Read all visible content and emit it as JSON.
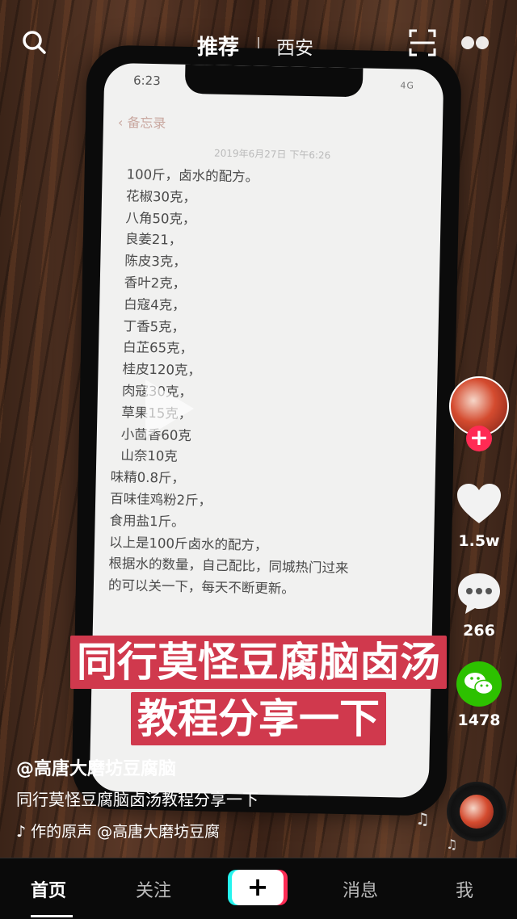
{
  "topbar": {
    "tab_recommend": "推荐",
    "tab_city": "西安"
  },
  "phone_screen": {
    "time": "6:23",
    "status": "4G",
    "back_label": "备忘录",
    "date": "2019年6月27日 下午6:26",
    "note_lines": [
      "100斤，卤水的配方。",
      "花椒30克，",
      "八角50克，",
      "良姜21，",
      "陈皮3克，",
      "香叶2克，",
      "白寇4克，",
      "丁香5克，",
      "白芷65克，",
      "桂皮120克，",
      "肉寇30克，",
      "草果15克，",
      "小茴香60克",
      "山奈10克",
      "味精0.8斤，",
      "百味佳鸡粉2斤，",
      "食用盐1斤。",
      "以上是100斤卤水的配方，",
      "根据水的数量，自己配比，同城热门过来",
      "的可以关一下，每天不断更新。"
    ]
  },
  "banner": {
    "line1": "同行莫怪豆腐脑卤汤",
    "line2": "教程分享一下"
  },
  "rail": {
    "likes": "1.5w",
    "comments": "266",
    "shares": "1478",
    "follow_symbol": "+"
  },
  "info": {
    "author": "@高唐大磨坊豆腐脑",
    "description": "同行莫怪豆腐脑卤汤教程分享一下",
    "music": "作的原声    @高唐大磨坊豆腐"
  },
  "nav": {
    "home": "首页",
    "follow": "关注",
    "plus": "+",
    "messages": "消息",
    "me": "我"
  },
  "colors": {
    "banner_bg": "#d0394d",
    "follow_red": "#ff2b54",
    "wechat_green": "#2dc100"
  }
}
